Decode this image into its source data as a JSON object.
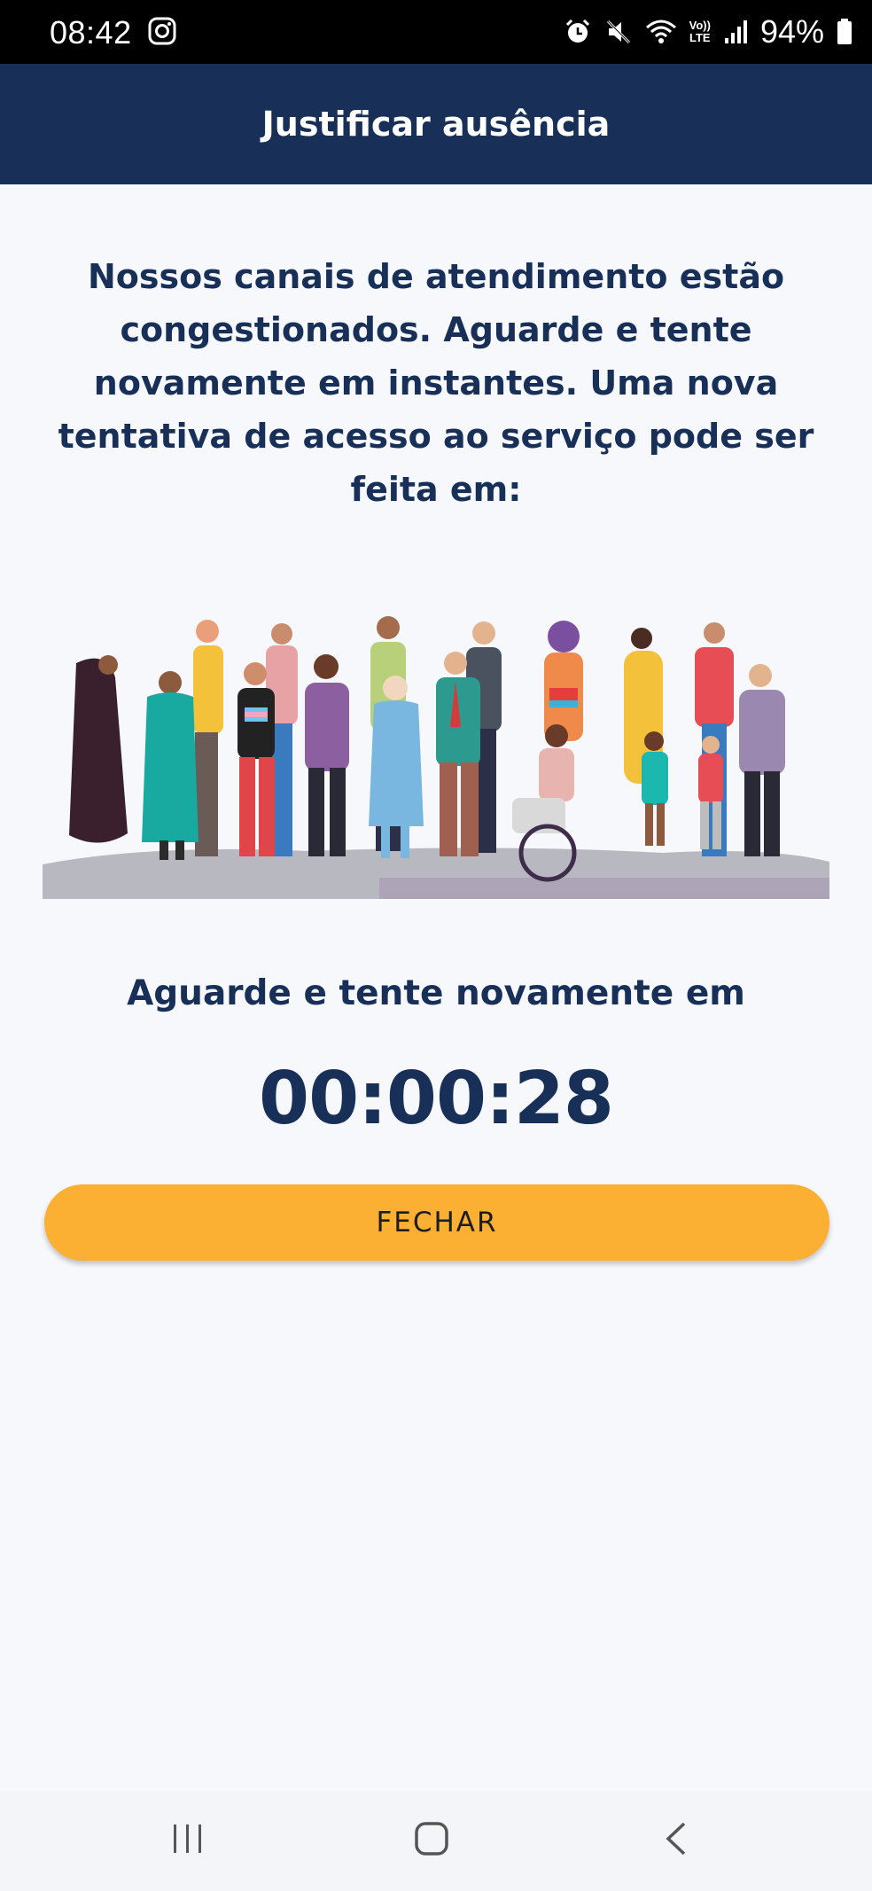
{
  "status_bar": {
    "time": "08:42",
    "left_icons": [
      "instagram-icon"
    ],
    "right_icons": [
      "alarm-icon",
      "mute-icon",
      "wifi-icon",
      "volte-icon",
      "signal-icon"
    ],
    "volte_top": "Vo))",
    "volte_bottom": "LTE",
    "battery": "94%"
  },
  "header": {
    "title": "Justificar ausência",
    "background": "#182f58"
  },
  "main": {
    "message": "Nossos canais de atendimento estão congestionados. Aguarde e tente novamente em instantes. Uma nova tentativa de acesso ao serviço pode ser feita em:",
    "illustration": "diverse-people-illustration",
    "wait_label": "Aguarde e tente novamente em",
    "countdown": "00:00:28",
    "close_label": "FECHAR",
    "accent": "#fbb034"
  },
  "nav_bar": {
    "icons": [
      "recent-apps-icon",
      "home-icon",
      "back-icon"
    ]
  }
}
